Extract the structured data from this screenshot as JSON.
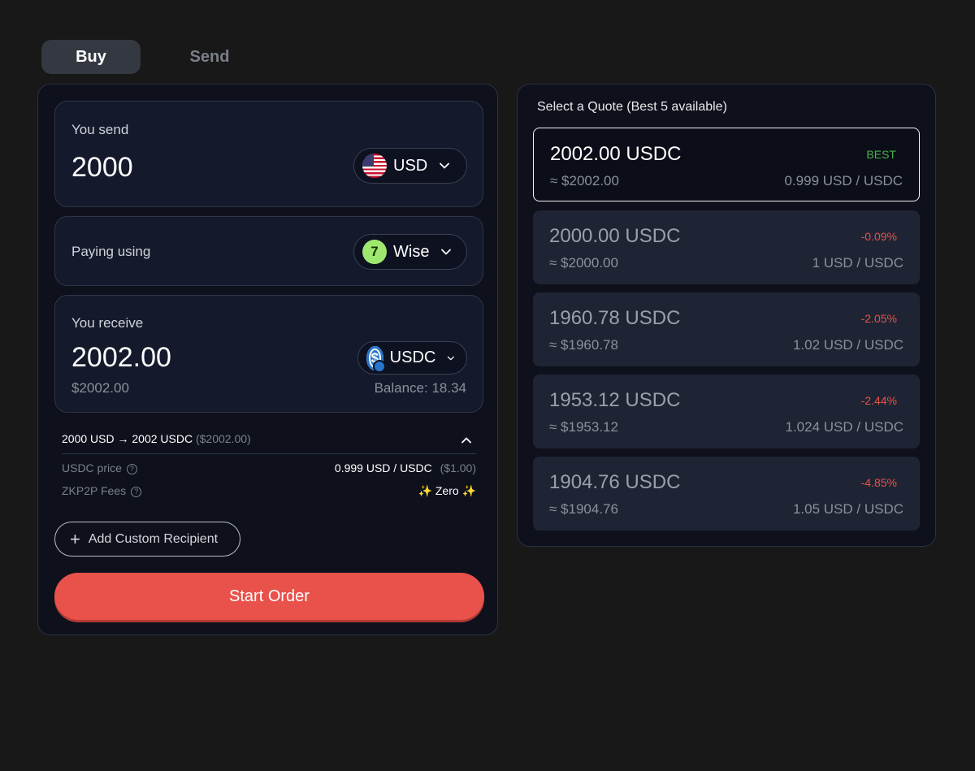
{
  "tabs": [
    {
      "label": "Buy",
      "active": true
    },
    {
      "label": "Send",
      "active": false
    }
  ],
  "send": {
    "label": "You send",
    "amount": "2000",
    "currency": "USD",
    "currency_icon": "us-flag-icon"
  },
  "paying": {
    "label": "Paying using",
    "method": "Wise",
    "method_icon": "wise-icon"
  },
  "receive": {
    "label": "You receive",
    "amount": "2002.00",
    "currency": "USDC",
    "currency_icon": "usdc-icon",
    "usd_value": "$2002.00",
    "balance": "Balance: 18.34"
  },
  "details": {
    "summary": "2000 USD → 2002 USDC",
    "summary_usd": "($2002.00)",
    "price_label": "USDC price",
    "price_value": "0.999 USD / USDC",
    "price_usd": "($1.00)",
    "fees_label": "ZKP2P Fees",
    "fees_value": "✨ Zero ✨"
  },
  "buttons": {
    "add_recipient": "Add Custom Recipient",
    "start_order": "Start Order"
  },
  "quotes": {
    "title": "Select a Quote (Best 5 available)",
    "items": [
      {
        "amount": "2002.00 USDC",
        "usd": "≈ $2002.00",
        "rate": "0.999 USD / USDC",
        "badge": "BEST",
        "selected": true
      },
      {
        "amount": "2000.00 USDC",
        "usd": "≈ $2000.00",
        "rate": "1 USD / USDC",
        "badge": "-0.09%",
        "selected": false
      },
      {
        "amount": "1960.78 USDC",
        "usd": "≈ $1960.78",
        "rate": "1.02 USD / USDC",
        "badge": "-2.05%",
        "selected": false
      },
      {
        "amount": "1953.12 USDC",
        "usd": "≈ $1953.12",
        "rate": "1.024 USD / USDC",
        "badge": "-2.44%",
        "selected": false
      },
      {
        "amount": "1904.76 USDC",
        "usd": "≈ $1904.76",
        "rate": "1.05 USD / USDC",
        "badge": "-4.85%",
        "selected": false
      }
    ]
  },
  "colors": {
    "accent": "#e8524b",
    "best": "#4caf50",
    "negative": "#e5534b",
    "background": "#181818",
    "panel": "#0e111b"
  }
}
